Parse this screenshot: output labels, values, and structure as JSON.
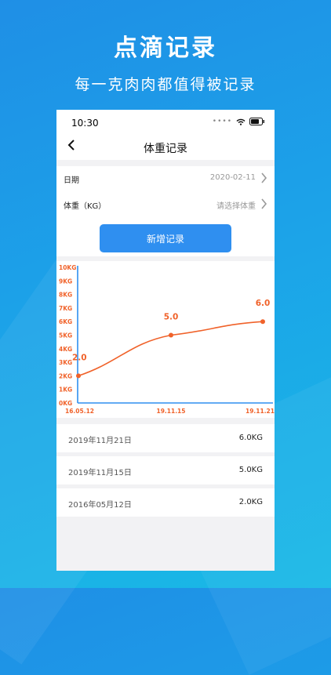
{
  "promo": {
    "title": "点滴记录",
    "subtitle": "每一克肉肉都值得被记录"
  },
  "status_bar": {
    "time": "10:30"
  },
  "nav": {
    "title": "体重记录"
  },
  "form": {
    "date_label": "日期",
    "date_value": "2020-02-11",
    "weight_label": "体重（KG）",
    "weight_placeholder": "请选择体重",
    "add_button": "新增记录"
  },
  "chart_data": {
    "type": "line",
    "categories": [
      "16.05.12",
      "19.11.15",
      "19.11.21"
    ],
    "values": [
      2.0,
      5.0,
      6.0
    ],
    "data_labels": [
      "2.0",
      "5.0",
      "6.0"
    ],
    "y_ticks": [
      "0KG",
      "1KG",
      "2KG",
      "3KG",
      "4KG",
      "5KG",
      "6KG",
      "7KG",
      "8KG",
      "9KG",
      "10KG"
    ],
    "ylim": [
      0,
      10
    ],
    "grid": false,
    "line_color": "#f0622a",
    "axis_color": "#2f8ff0"
  },
  "records": [
    {
      "date": "2019年11月21日",
      "weight": "6.0KG"
    },
    {
      "date": "2019年11月15日",
      "weight": "5.0KG"
    },
    {
      "date": "2016年05月12日",
      "weight": "2.0KG"
    }
  ]
}
